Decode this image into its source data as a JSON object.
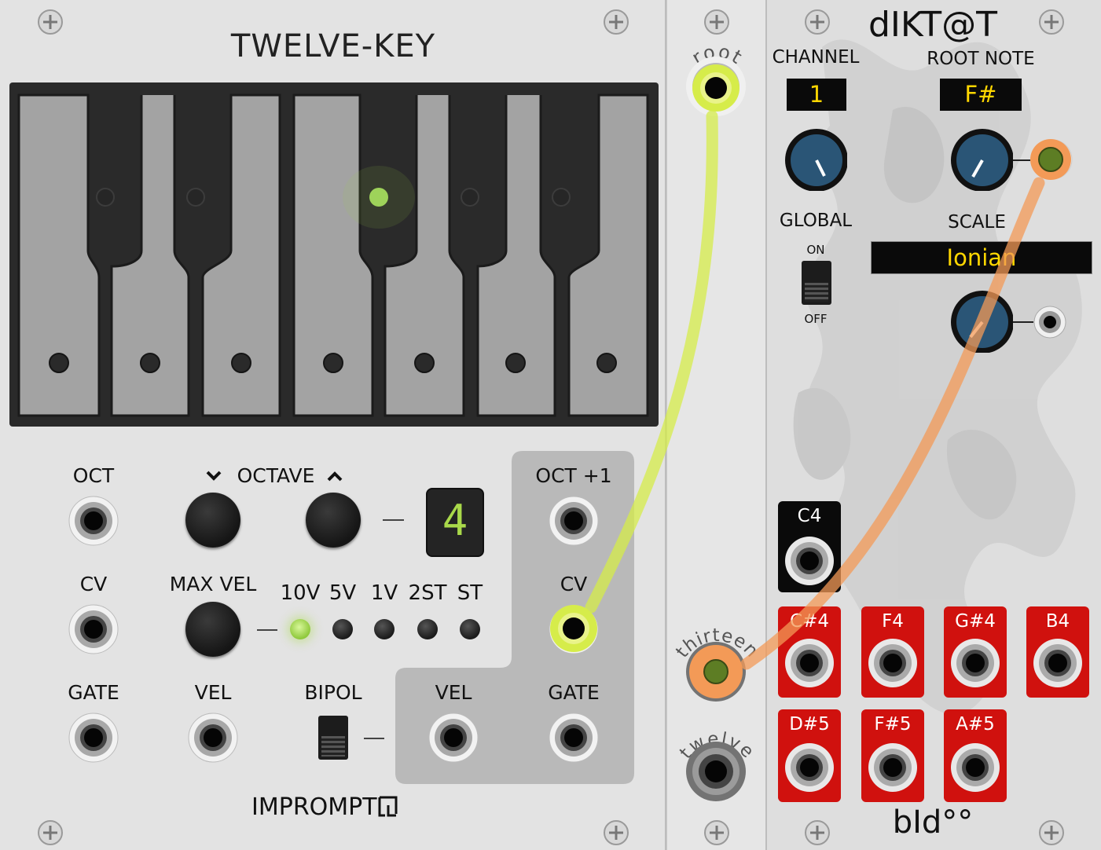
{
  "twelvekey": {
    "title": "TWELVE-KEY",
    "brand": "IMPROMPT",
    "labels": {
      "oct": "OCT",
      "octave": "OCTAVE",
      "cv": "CV",
      "max_vel": "MAX VEL",
      "gate": "GATE",
      "vel": "VEL",
      "bipol": "BIPOL",
      "oct_plus1": "OCT +1",
      "cv_out": "CV",
      "vel_out": "VEL",
      "gate_out": "GATE"
    },
    "octave_display": "4",
    "octave_down_icon": "chevron-down-icon",
    "octave_up_icon": "chevron-up-icon",
    "velocity_ranges": [
      "10V",
      "5V",
      "1V",
      "2ST",
      "ST"
    ],
    "velocity_range_selected": "10V",
    "keyboard": {
      "lit_key": "F#",
      "accent_led": "#a6d656"
    }
  },
  "midmodule": {
    "root_label": "root",
    "thirteen_label": "thirteen",
    "twelve_label": "twelve"
  },
  "diktat": {
    "title": "dIKT@T",
    "channel_label": "CHANNEL",
    "channel_value": "1",
    "root_note_label": "ROOT NOTE",
    "root_note_value": "F#",
    "global_label": "GLOBAL",
    "global_on": "ON",
    "global_off": "OFF",
    "scale_label": "SCALE",
    "scale_value": "Ionian",
    "outputs_row1": [
      "C#4",
      "F4",
      "G#4",
      "B4"
    ],
    "outputs_row2": [
      "D#5",
      "F#5",
      "A#5"
    ],
    "root_output": "C4",
    "brand": "bId°°",
    "display_color": "#ffd700",
    "output_color": "#d0110e"
  },
  "cables": {
    "yellow_color": "#d6ec4a",
    "orange_color": "#f39a57"
  }
}
